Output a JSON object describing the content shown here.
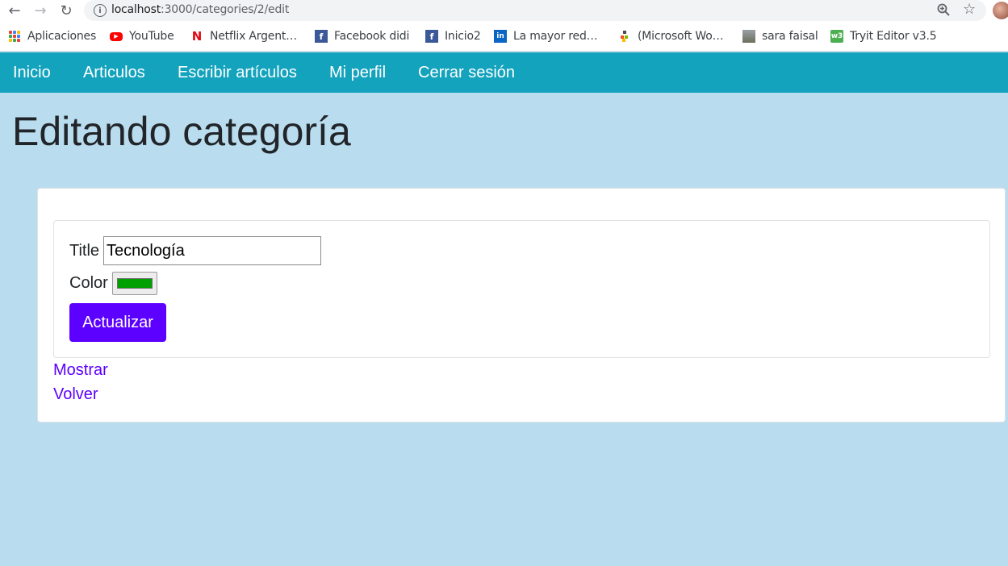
{
  "browser": {
    "url_host": "localhost",
    "url_path": ":3000/categories/2/edit",
    "bookmarks": [
      {
        "label": "Aplicaciones",
        "icon": "apps-grid-icon"
      },
      {
        "label": "YouTube",
        "icon": "youtube-icon"
      },
      {
        "label": "Netflix Argent…",
        "icon": "netflix-icon"
      },
      {
        "label": "Facebook didi",
        "icon": "facebook-icon"
      },
      {
        "label": "Inicio2",
        "icon": "facebook-icon"
      },
      {
        "label": "La mayor red…",
        "icon": "linkedin-icon"
      },
      {
        "label": "(Microsoft Wo…",
        "icon": "microsoft-icon"
      },
      {
        "label": "sara faisal",
        "icon": "image-thumbnail-icon"
      },
      {
        "label": "Tryit Editor v3.5",
        "icon": "w3schools-icon"
      }
    ]
  },
  "navbar": {
    "items": [
      {
        "label": "Inicio"
      },
      {
        "label": "Articulos"
      },
      {
        "label": "Escribir artículos"
      },
      {
        "label": "Mi perfil"
      },
      {
        "label": "Cerrar sesión"
      }
    ],
    "background": "#13a3bd"
  },
  "page": {
    "title": "Editando categoría"
  },
  "form": {
    "title_label": "Title",
    "title_value": "Tecnología",
    "color_label": "Color",
    "color_value": "#00a000",
    "submit_label": "Actualizar"
  },
  "links": {
    "show": "Mostrar",
    "back": "Volver"
  },
  "colors": {
    "page_background": "#b9ddee",
    "accent": "#5c00ff"
  }
}
